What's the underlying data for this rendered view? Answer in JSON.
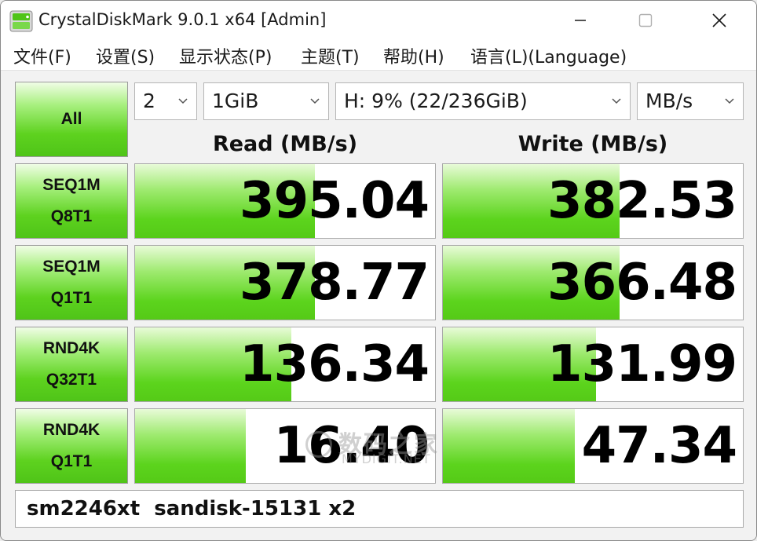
{
  "window": {
    "title": "CrystalDiskMark 9.0.1 x64 [Admin]"
  },
  "menu": [
    "文件(F)",
    "设置(S)",
    "显示状态(P)",
    "主题(T)",
    "帮助(H)",
    "语言(L)(Language)"
  ],
  "controls": {
    "all_label": "All",
    "count": "2",
    "size": "1GiB",
    "drive": "H: 9% (22/236GiB)",
    "unit": "MB/s"
  },
  "headers": {
    "read": "Read (MB/s)",
    "write": "Write (MB/s)"
  },
  "tests": [
    {
      "line1": "SEQ1M",
      "line2": "Q8T1",
      "read": "395.04",
      "read_fill": 0.6,
      "write": "382.53",
      "write_fill": 0.59
    },
    {
      "line1": "SEQ1M",
      "line2": "Q1T1",
      "read": "378.77",
      "read_fill": 0.6,
      "write": "366.48",
      "write_fill": 0.59
    },
    {
      "line1": "RND4K",
      "line2": "Q32T1",
      "read": "136.34",
      "read_fill": 0.52,
      "write": "131.99",
      "write_fill": 0.51
    },
    {
      "line1": "RND4K",
      "line2": "Q1T1",
      "read": "16.40",
      "read_fill": 0.37,
      "write": "47.34",
      "write_fill": 0.44
    }
  ],
  "comment": "sm2246xt  sandisk-15131 x2",
  "watermark": {
    "main": "数码之家",
    "sub": "MYDIGIT.NET"
  },
  "icons": {
    "app": "crystaldiskmark-app-icon",
    "minimize": "minimize-icon",
    "maximize": "maximize-icon",
    "close": "close-icon",
    "dropdown": "chevron-down-icon"
  },
  "colors": {
    "bar_green": "#5cd41d",
    "button_green": "#5ed21f"
  }
}
